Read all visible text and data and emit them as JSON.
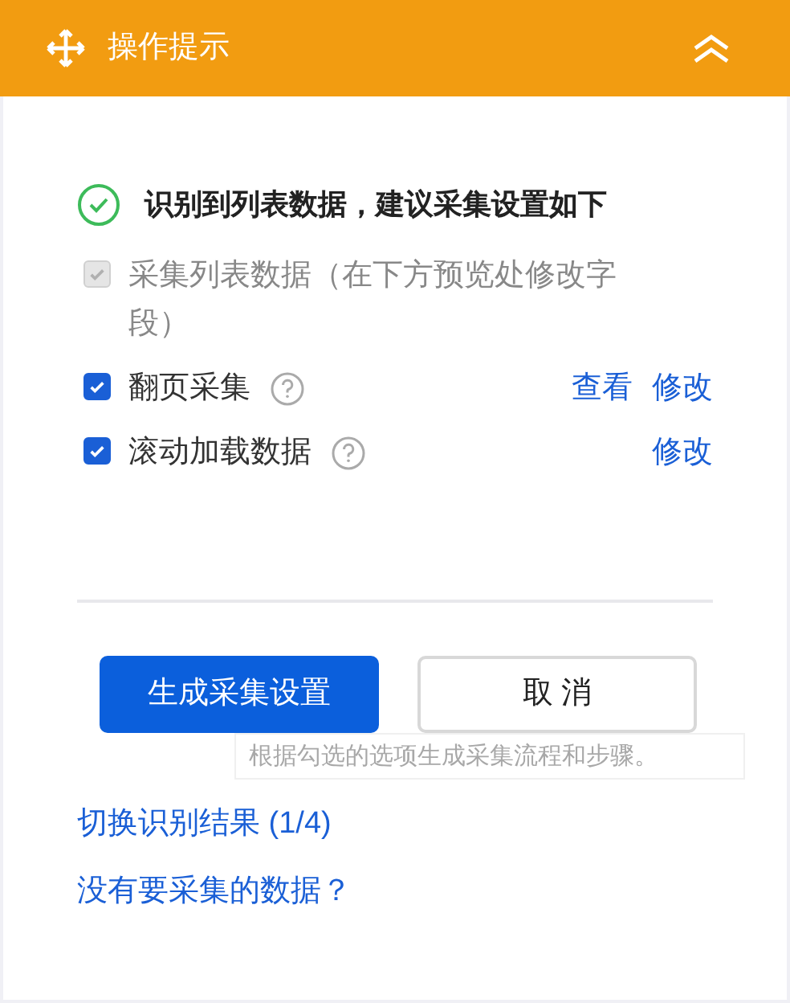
{
  "header": {
    "title": "操作提示",
    "collapsed": false
  },
  "message": "识别到列表数据，建议采集设置如下",
  "options": [
    {
      "label": "采集列表数据（在下方预览处修改字段）",
      "checked": true,
      "disabled": true,
      "help": false
    },
    {
      "label": "翻页采集",
      "checked": true,
      "disabled": false,
      "help": true,
      "actions": [
        "查看",
        "修改"
      ]
    },
    {
      "label": "滚动加载数据",
      "checked": true,
      "disabled": false,
      "help": true,
      "actions": [
        "修改"
      ]
    }
  ],
  "buttons": [
    {
      "label": "生成采集设置",
      "kind": "primary"
    },
    {
      "label": "取 消",
      "kind": "secondary"
    }
  ],
  "tooltip": "根据勾选的选项生成采集流程和步骤。",
  "links": [
    "切换识别结果 (1/4)",
    "没有要采集的数据？"
  ]
}
